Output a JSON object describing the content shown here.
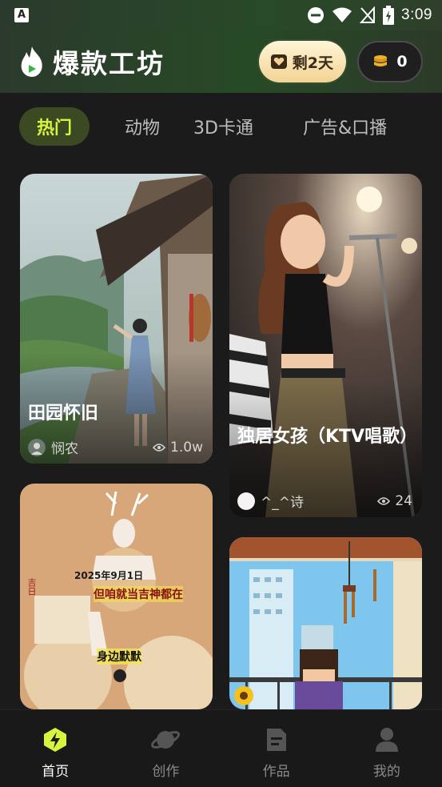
{
  "status_bar": {
    "time": "3:09",
    "icons": [
      "app-notification-icon",
      "dnd-icon",
      "wifi-icon",
      "no-signal-icon",
      "battery-charging-icon"
    ]
  },
  "header": {
    "app_name": "爆款工坊",
    "vip_label": "剩2天",
    "coin_count": "0"
  },
  "tabs": [
    {
      "label": "热门",
      "active": true
    },
    {
      "label": "动物",
      "active": false
    },
    {
      "label": "3D卡通",
      "active": false
    },
    {
      "label": "广告&口播",
      "active": false
    }
  ],
  "cards": [
    {
      "title": "田园怀旧",
      "author": "悯农",
      "views": "1.0w"
    },
    {
      "title": "独居女孩（KTV唱歌）",
      "author": "^_^诗",
      "views": "24"
    },
    {
      "title": "",
      "author": "",
      "views": "",
      "image_text": {
        "date": "2025年9月1日",
        "line1": "但咱就当吉神都在",
        "line2": "身边默默",
        "side": "吉日"
      }
    },
    {
      "title": "",
      "author": "",
      "views": ""
    }
  ],
  "bottom_nav": [
    {
      "label": "首页",
      "icon": "lightning-icon",
      "active": true
    },
    {
      "label": "创作",
      "icon": "planet-icon",
      "active": false
    },
    {
      "label": "作品",
      "icon": "document-icon",
      "active": false
    },
    {
      "label": "我的",
      "icon": "user-icon",
      "active": false
    }
  ],
  "colors": {
    "accent": "#d7f43f",
    "active_tab_bg": "#3c4a24",
    "vip_gold": "#f2d393",
    "background": "#1b1b1b"
  }
}
